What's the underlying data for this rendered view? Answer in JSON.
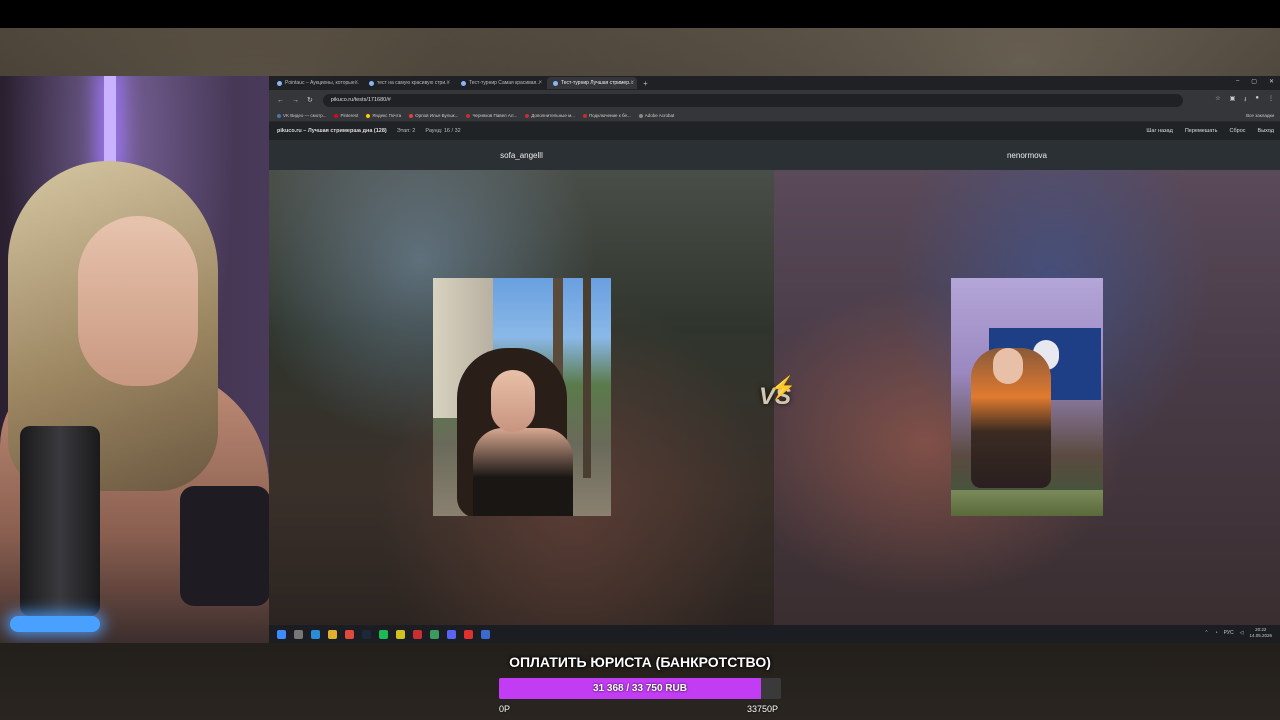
{
  "browser": {
    "tabs": [
      {
        "label": "Pointauc – Аукционы, которые..."
      },
      {
        "label": "тест на самую красивую стри..."
      },
      {
        "label": "Тест-турнир Самая красивая..."
      },
      {
        "label": "Тест-турнир Лучшая стример..."
      }
    ],
    "new_tab": "+",
    "window_controls": [
      "–",
      "▢",
      "✕"
    ],
    "url": "pikuco.ru/tests/171680/#",
    "bookmarks": [
      {
        "label": "VK Видео — смотр...",
        "color": "#4a76a8"
      },
      {
        "label": "Pinterest",
        "color": "#e60023"
      },
      {
        "label": "Яндекс Почта",
        "color": "#ffcc00"
      },
      {
        "label": "Орлов Илья Бульж...",
        "color": "#e04040"
      },
      {
        "label": "Черняков Павел Ал...",
        "color": "#c03030"
      },
      {
        "label": "Дополнительные м...",
        "color": "#c03030"
      },
      {
        "label": "Подключение к бе...",
        "color": "#c03030"
      },
      {
        "label": "Adobe Acrobat",
        "color": "#888888"
      }
    ],
    "all_bookmarks": "Все закладки"
  },
  "site": {
    "title": "pikuco.ru – Лучшая стримерша дна (128)",
    "stage": "Этап: 2",
    "round": "Раунд: 16 / 32",
    "actions": [
      "Шаг назад",
      "Перемешать",
      "Сброс",
      "Выход"
    ]
  },
  "duel": {
    "left_name": "sofa_angelll",
    "right_name": "nenormova",
    "vs_label": "VS"
  },
  "taskbar": {
    "lang": "РУС",
    "time": "20:22",
    "date": "14.05.2026"
  },
  "goal": {
    "title": "ОПЛАТИТЬ ЮРИСТА (БАНКРОТСТВО)",
    "progress_text": "31 368 / 33 750 RUB",
    "progress_fraction": 0.929,
    "min_label": "0Р",
    "max_label": "33750Р",
    "fill_color": "#c23cf4"
  }
}
